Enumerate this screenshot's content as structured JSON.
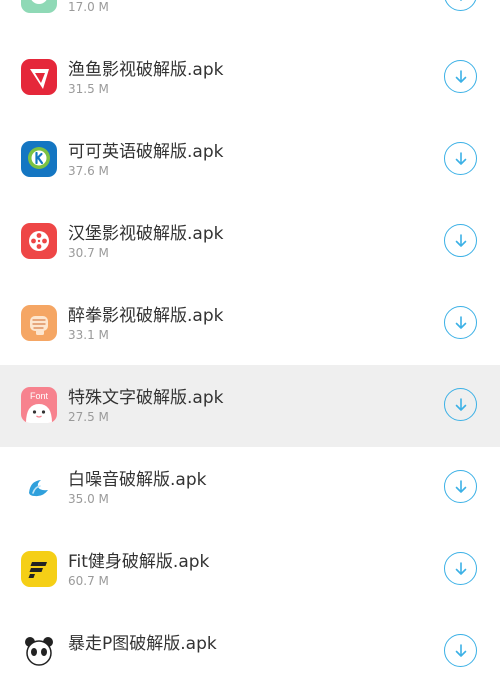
{
  "apps": [
    {
      "name": "",
      "size": "17.0 M",
      "icon": "mint-app-icon",
      "color": "#8fd9b6"
    },
    {
      "name": "渔鱼影视破解版.apk",
      "size": "31.5 M",
      "icon": "video-play-icon",
      "color": "#e5273a"
    },
    {
      "name": "可可英语破解版.apk",
      "size": "37.6 M",
      "icon": "kekeenglish-k-icon",
      "color": "#1476c2"
    },
    {
      "name": "汉堡影视破解版.apk",
      "size": "30.7 M",
      "icon": "film-reel-icon",
      "color": "#ee4646"
    },
    {
      "name": "醉拳影视破解版.apk",
      "size": "33.1 M",
      "icon": "fist-icon",
      "color": "#f5a664"
    },
    {
      "name": "特殊文字破解版.apk",
      "size": "27.5 M",
      "icon": "font-face-icon",
      "color": "#f7828e"
    },
    {
      "name": "白噪音破解版.apk",
      "size": "35.0 M",
      "icon": "wave-icon",
      "color": "#2fa0dc"
    },
    {
      "name": "Fit健身破解版.apk",
      "size": "60.7 M",
      "icon": "fit-f-icon",
      "color": "#f5cf16"
    },
    {
      "name": "暴走P图破解版.apk",
      "size": "",
      "icon": "panda-face-icon",
      "color": "#222222"
    }
  ],
  "highlighted_index": 5,
  "download_color": "#3cb1e6"
}
